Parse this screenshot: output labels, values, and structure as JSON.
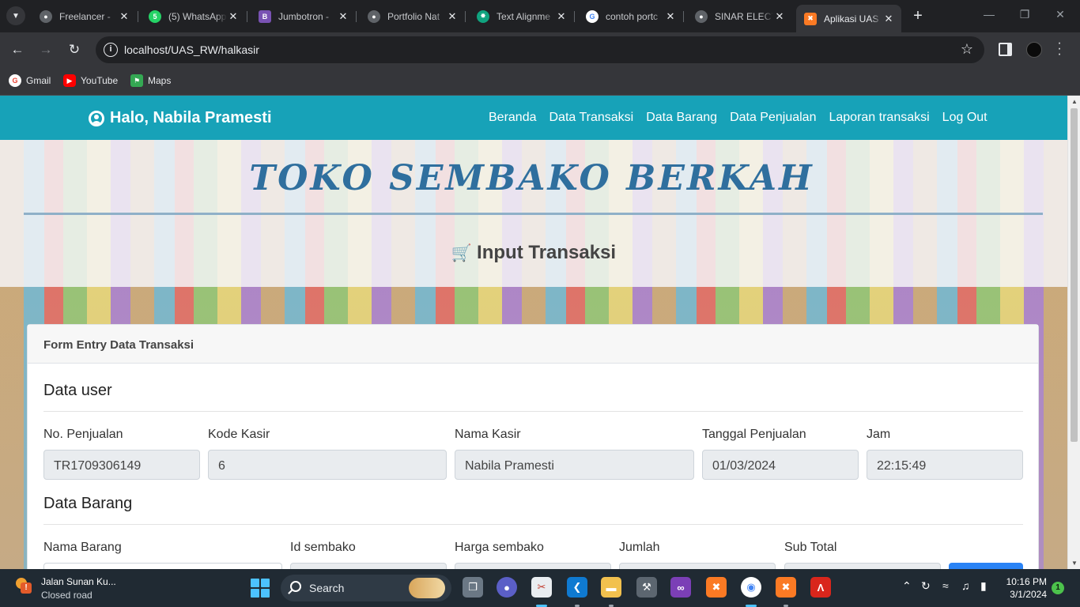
{
  "browser": {
    "tabs": [
      {
        "title": "Freelancer - ",
        "icon": "globe-icon",
        "color": "#9aa0a6"
      },
      {
        "title": "(5) WhatsApp",
        "icon": "whatsapp-icon",
        "color": "#25d366"
      },
      {
        "title": "Jumbotron - ",
        "icon": "bootstrap-icon",
        "color": "#7952b3"
      },
      {
        "title": "Portfolio Nat",
        "icon": "github-icon",
        "color": "#9aa0a6"
      },
      {
        "title": "Text Alignme",
        "icon": "chatgpt-icon",
        "color": "#10a37f"
      },
      {
        "title": "contoh portc",
        "icon": "google-icon",
        "color": "#4285f4"
      },
      {
        "title": "SINAR ELECT",
        "icon": "globe-icon",
        "color": "#9aa0a6"
      },
      {
        "title": "Aplikasi UAS",
        "icon": "xampp-icon",
        "color": "#fb7a24"
      }
    ],
    "active_tab": 7,
    "url": "localhost/UAS_RW/halkasir",
    "bookmarks": [
      {
        "label": "Gmail",
        "icon": "google-icon",
        "color": "#ea4335"
      },
      {
        "label": "YouTube",
        "icon": "youtube-icon",
        "color": "#ff0000"
      },
      {
        "label": "Maps",
        "icon": "maps-icon",
        "color": "#34a853"
      }
    ]
  },
  "page": {
    "greeting": "Halo, Nabila Pramesti",
    "nav": [
      "Beranda",
      "Data Transaksi",
      "Data Barang",
      "Data Penjualan",
      "Laporan transaksi",
      "Log Out"
    ],
    "shop_title": "TOKO SEMBAKO BERKAH",
    "section_title": "Input Transaksi",
    "card_title": "Form Entry Data Transaksi",
    "user_section": "Data user",
    "user_fields": [
      {
        "label": "No. Penjualan",
        "value": "TR1709306149"
      },
      {
        "label": "Kode Kasir",
        "value": "6"
      },
      {
        "label": "Nama Kasir",
        "value": "Nabila Pramesti"
      },
      {
        "label": "Tanggal Penjualan",
        "value": "01/03/2024"
      },
      {
        "label": "Jam",
        "value": "22:15:49"
      }
    ],
    "barang_section": "Data Barang",
    "barang_fields": [
      {
        "label": "Nama Barang"
      },
      {
        "label": "Id sembako"
      },
      {
        "label": "Harga sembako"
      },
      {
        "label": "Jumlah"
      },
      {
        "label": "Sub Total"
      }
    ],
    "colors": {
      "navbar": "#17a2b8",
      "title": "#2f6f9e",
      "button": "#2a83f5"
    }
  },
  "taskbar": {
    "weather_title": "Jalan Sunan Ku...",
    "weather_sub": "Closed road",
    "search_label": "Search",
    "time": "10:16 PM",
    "date": "3/1/2024",
    "notifications": "1"
  }
}
